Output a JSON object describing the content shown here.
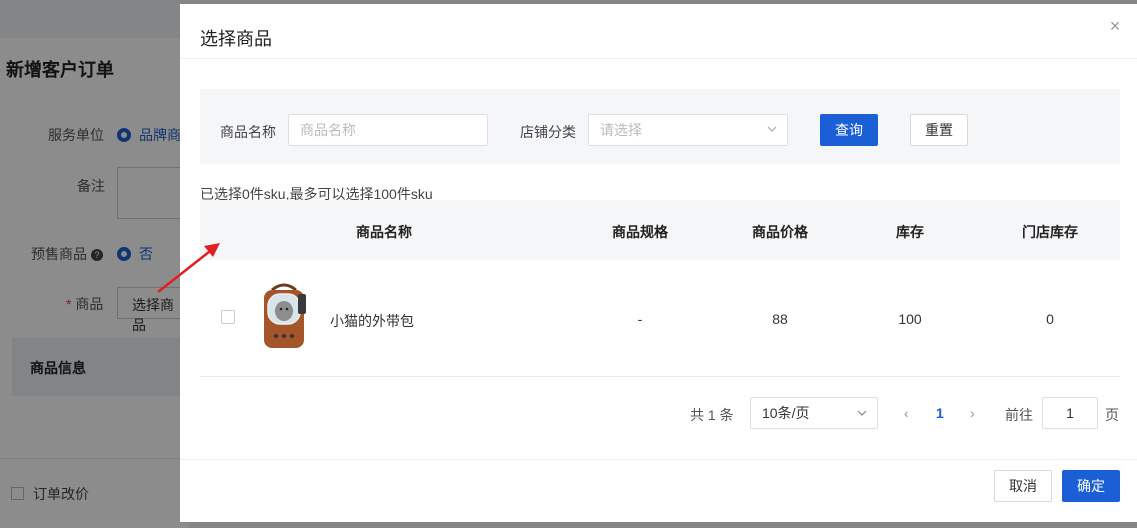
{
  "background": {
    "page_title": "新增客户订单",
    "service_unit_label": "服务单位",
    "service_unit_value": "品牌商",
    "remark_label": "备注",
    "presale_label": "预售商品",
    "presale_value": "否",
    "product_label": "商品",
    "select_product_button": "选择商品",
    "product_info_section": "商品信息",
    "order_price_change_label": "订单改价",
    "help_icon_text": "?",
    "required_mark": "*"
  },
  "modal": {
    "title": "选择商品",
    "close_glyph": "×",
    "filter": {
      "name_label": "商品名称",
      "name_placeholder": "商品名称",
      "category_label": "店铺分类",
      "category_placeholder": "请选择",
      "query_button": "查询",
      "reset_button": "重置"
    },
    "selected_info": "已选择0件sku,最多可以选择100件sku",
    "table": {
      "columns": [
        "商品名称",
        "商品规格",
        "商品价格",
        "库存",
        "门店库存"
      ],
      "rows": [
        {
          "name": "小猫的外带包",
          "spec": "-",
          "price": "88",
          "stock": "100",
          "store_stock": "0",
          "image": "cat-backpack-image"
        }
      ]
    },
    "pagination": {
      "total": "共 1 条",
      "page_size": "10条/页",
      "current_page": "1",
      "goto_label": "前往",
      "goto_value": "1",
      "page_suffix": "页"
    },
    "footer": {
      "cancel_button": "取消",
      "confirm_button": "确定"
    }
  },
  "colors": {
    "primary": "#1a5fd6",
    "annotation_arrow": "#e02020"
  }
}
